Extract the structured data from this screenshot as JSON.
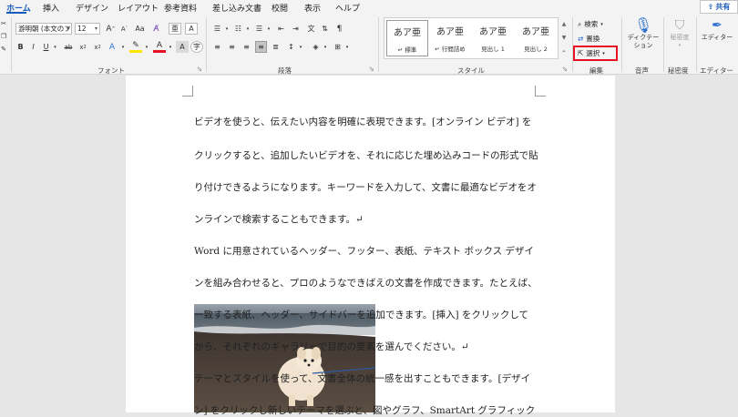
{
  "tabs": [
    "ホーム",
    "挿入",
    "デザイン",
    "レイアウト",
    "参考資料",
    "差し込み文書",
    "校閲",
    "表示",
    "ヘルプ"
  ],
  "share_label": "共有",
  "font": {
    "name_value": "游明朝 (本文のフ",
    "size_value": "12",
    "group_label": "フォント"
  },
  "paragraph": {
    "group_label": "段落"
  },
  "styles": {
    "group_label": "スタイル",
    "items": [
      {
        "preview": "あア亜",
        "name": "標準"
      },
      {
        "preview": "あア亜",
        "name": "行間詰め"
      },
      {
        "preview": "あア亜",
        "name": "見出し 1"
      },
      {
        "preview": "あア亜",
        "name": "見出し 2"
      }
    ]
  },
  "editing": {
    "group_label": "編集",
    "find_label": "検索",
    "replace_label": "置換",
    "select_label": "選択"
  },
  "voice": {
    "group_label": "音声",
    "dictate_label": "ディクテーション"
  },
  "sensitivity": {
    "group_label": "秘密度",
    "label": "秘密度"
  },
  "editor": {
    "group_label": "エディター",
    "label": "エディター"
  },
  "document": {
    "lines": [
      "ビデオを使うと、伝えたい内容を明確に表現できます。[オンライン ビデオ] を",
      "クリックすると、追加したいビデオを、それに応じた埋め込みコードの形式で貼",
      "り付けできるようになります。キーワードを入力して、文書に最適なビデオをオ",
      "ンラインで検索することもできます。↵",
      "Word に用意されているヘッダー、フッター、表紙、テキスト ボックス デザイ",
      "ンを組み合わせると、プロのようなできばえの文書を作成できます。たとえば、",
      "一致する表紙、ヘッダー、サイドバーを追加できます。[挿入] をクリックして",
      "から、それぞれのギャラリーで目的の要素を選んでください。↵",
      "テーマとスタイルを使って、文書全体の統一感を出すこともできます。[デザイ",
      "ン] をクリックし新しいテーマを選ぶと、図やグラフ、SmartArt グラフィック"
    ]
  }
}
